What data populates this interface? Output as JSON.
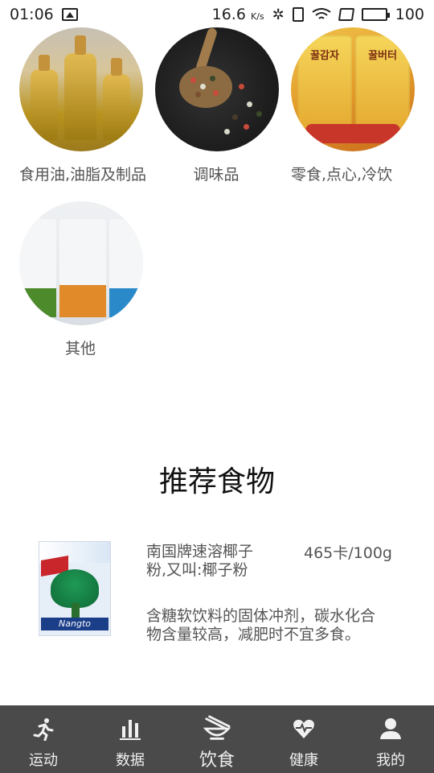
{
  "status_bar": {
    "time": "01:06",
    "speed": "16.6",
    "speed_unit": "K/s",
    "battery": "100"
  },
  "categories": [
    {
      "label": "食用油,油脂及制品",
      "icon": "oil-image"
    },
    {
      "label": "调味品",
      "icon": "spice-image"
    },
    {
      "label": "零食,点心,冷饮",
      "icon": "snack-image"
    },
    {
      "label": "其他",
      "icon": "jar-image"
    }
  ],
  "recommended": {
    "title": "推荐食物",
    "items": [
      {
        "name": "南国牌速溶椰子粉,又叫:椰子粉",
        "calories": "465卡/100g",
        "description": "含糖软饮料的固体冲剂，碳水化合物含量较高，减肥时不宜多食。",
        "image": "coconut-powder-package",
        "brand_text": "Nangto"
      }
    ]
  },
  "bottom_nav": [
    {
      "label": "运动",
      "icon": "running-icon",
      "active": false
    },
    {
      "label": "数据",
      "icon": "bar-chart-icon",
      "active": false
    },
    {
      "label": "饮食",
      "icon": "bowl-chopsticks-icon",
      "active": true
    },
    {
      "label": "健康",
      "icon": "heart-icon",
      "active": false
    },
    {
      "label": "我的",
      "icon": "user-icon",
      "active": false
    }
  ],
  "colors": {
    "nav_background": "#4a4a4a",
    "text_gray": "#555555",
    "title": "#111111"
  }
}
